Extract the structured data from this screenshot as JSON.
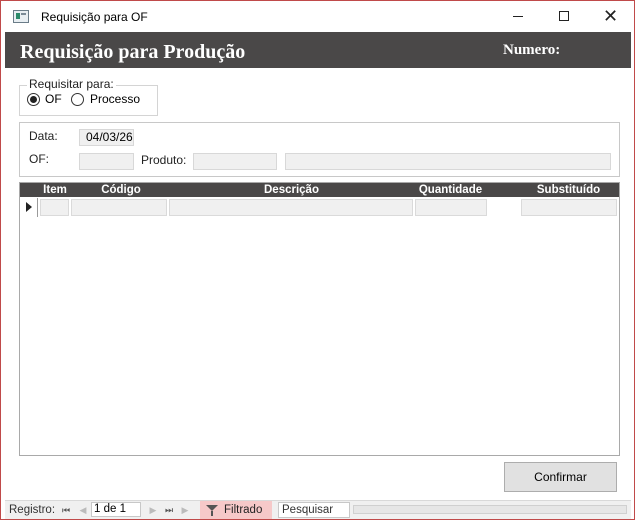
{
  "window": {
    "title": "Requisição para OF"
  },
  "header": {
    "title": "Requisição para Produção",
    "numero_label": "Numero:"
  },
  "requisitar": {
    "legend": "Requisitar para:",
    "options": [
      {
        "label": "OF",
        "checked": true
      },
      {
        "label": "Processo",
        "checked": false
      }
    ]
  },
  "form": {
    "data_label": "Data:",
    "data_value": "04/03/26",
    "of_label": "OF:",
    "of_value": "",
    "produto_label": "Produto:",
    "produto_code": "",
    "produto_desc": ""
  },
  "grid": {
    "columns": [
      "Item",
      "Código",
      "Descrição",
      "Quantidade",
      "Substituído"
    ],
    "rows": [
      {
        "item": "",
        "codigo": "",
        "descricao": "",
        "quantidade": "",
        "substituido": ""
      }
    ]
  },
  "actions": {
    "confirm_label": "Confirmar"
  },
  "navigation": {
    "registro_label": "Registro:",
    "record": "1 de 1",
    "filter_label": "Filtrado",
    "search_placeholder": "Pesquisar"
  },
  "icons": {
    "min": "minimize-icon",
    "max": "maximize-icon",
    "close": "close-icon",
    "filter": "filter-icon"
  },
  "colors": {
    "header_band": "#4a4848",
    "filter_bg": "#f6c9c9"
  }
}
